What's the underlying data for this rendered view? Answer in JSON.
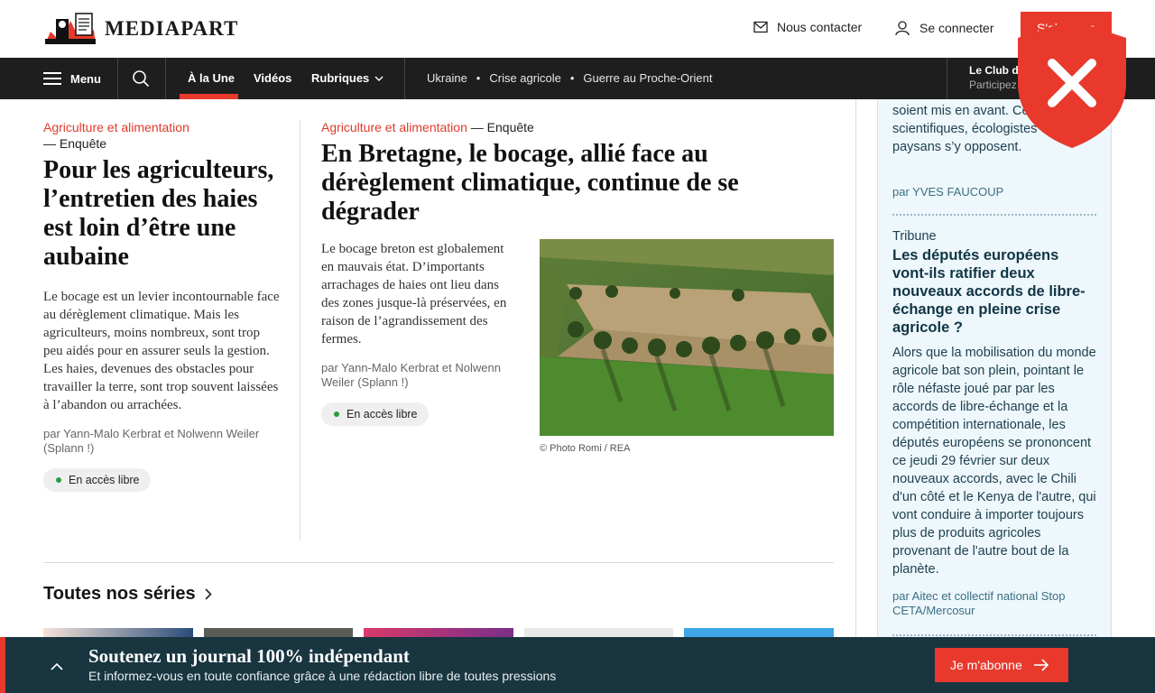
{
  "header": {
    "logo_text": "MEDIAPART",
    "contact_label": "Nous contacter",
    "login_label": "Se connecter",
    "subscribe_label": "S'abonner"
  },
  "nav": {
    "menu_label": "Menu",
    "items": [
      "À la Une",
      "Vidéos",
      "Rubriques"
    ],
    "topics": [
      "Ukraine",
      "Crise agricole",
      "Guerre au Proche-Orient"
    ],
    "club_title": "Le Club d",
    "club_sub": "Participez"
  },
  "left_article": {
    "kicker": "Agriculture et alimentation",
    "type": "— Enquête",
    "title": "Pour les agriculteurs, l’entretien des haies est loin d’être une aubaine",
    "description": "Le bocage est un levier incontournable face au dérèglement climatique. Mais les agriculteurs, moins nombreux, sont trop peu aidés pour en assurer seuls la gestion. Les haies, devenues des obstacles pour travailler la terre, sont trop souvent laissées à l’abandon ou arrachées.",
    "byline": "par Yann-Malo Kerbrat et Nolwenn Weiler (Splann !)",
    "access": "En accès libre"
  },
  "center_article": {
    "kicker": "Agriculture et alimentation",
    "type": " — Enquête",
    "title": "En Bretagne, le bocage, allié face au dérèglement climatique, continue de se dégrader",
    "description": "Le bocage breton est globalement en mauvais état. D’importants arrachages de haies ont lieu dans des zones jusque-là préservées, en raison de l’agrandissement des fermes.",
    "byline": "par Yann-Malo Kerbrat et Nolwenn Weiler (Splann !)",
    "access": "En accès libre",
    "photo_credit": "© Photo Romi / REA"
  },
  "series": {
    "title": "Toutes nos séries"
  },
  "club": {
    "first_text": "soient mis en avant. Ce riverains, scientifiques, écologistes et paysans s’y opposent.",
    "first_byline": "par YVES FAUCOUP",
    "second_kicker": "Tribune",
    "second_title": "Les députés européens vont-ils ratifier deux nouveaux accords de libre-échange en pleine crise agricole ?",
    "second_text": "Alors que la mobilisation du monde agricole bat son plein, pointant le rôle néfaste joué par par les accords de libre-échange et la compétition internationale, les députés européens se prononcent ce jeudi 29 février sur deux nouveaux accords, avec le Chili d'un côté et le Kenya de l'autre, qui vont conduire à importer toujours plus de produits agricoles provenant de l'autre bout de la planète.",
    "second_byline": "par Aitec et collectif national Stop CETA/Mercosur"
  },
  "banner": {
    "title": "Soutenez un journal 100% indépendant",
    "subtitle": "Et informez-vous en toute confiance grâce à une rédaction libre de toutes pressions",
    "button_label": "Je m'abonne"
  },
  "colors": {
    "accent_red": "#e8392c",
    "nav_bg": "#1e1e1e",
    "banner_bg": "#183540",
    "club_bg": "#eef7fb"
  }
}
